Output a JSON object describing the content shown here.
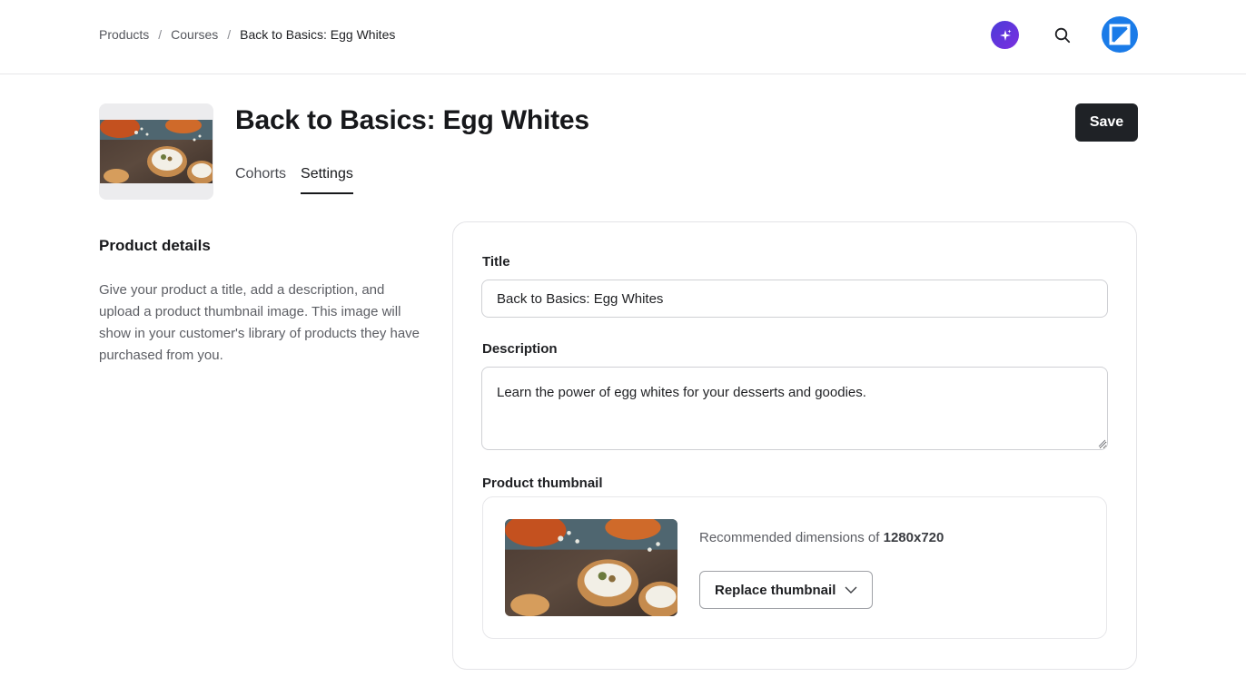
{
  "breadcrumb": {
    "items": [
      "Products",
      "Courses"
    ],
    "separator": "/",
    "current": "Back to Basics: Egg Whites"
  },
  "icons": {
    "ai": "sparkle-icon",
    "search": "search-icon",
    "avatar": "brand-logo-icon"
  },
  "colors": {
    "accent": "#1f2226",
    "ai_gradient_start": "#4b3bd8",
    "ai_gradient_end": "#7b2fe0",
    "avatar_bg": "#1a7be8"
  },
  "header": {
    "title": "Back to Basics: Egg Whites",
    "save_label": "Save",
    "tabs": [
      {
        "label": "Cohorts",
        "active": false
      },
      {
        "label": "Settings",
        "active": true
      }
    ]
  },
  "details": {
    "title": "Product details",
    "description": "Give your product a title, add a description, and upload a product thumbnail image. This image will show in your customer's library of products they have purchased from you."
  },
  "form": {
    "title_label": "Title",
    "title_value": "Back to Basics: Egg Whites",
    "description_label": "Description",
    "description_value": "Learn the power of egg whites for your desserts and goodies.",
    "thumbnail_label": "Product thumbnail",
    "recommended_prefix": "Recommended dimensions of",
    "recommended_size": "1280x720",
    "replace_label": "Replace thumbnail"
  }
}
